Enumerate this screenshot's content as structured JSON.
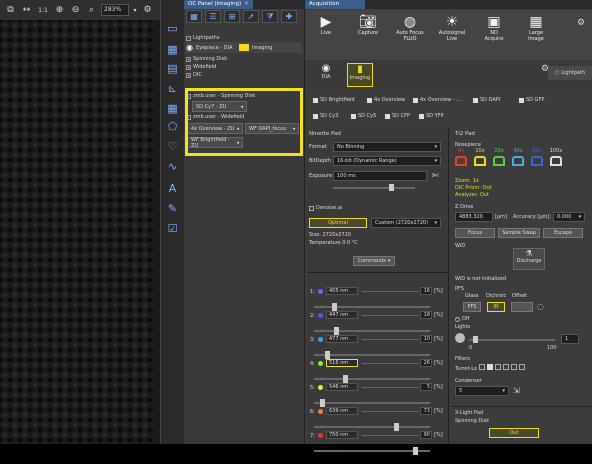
{
  "viewer": {
    "zoom": "283%",
    "scale_label": "1:1"
  },
  "oc_panel": {
    "tab": "OC Panel (Imaging)",
    "tree": [
      "Lightpaths",
      "Spinning Disk",
      "Widefield",
      "DIC"
    ],
    "eyepiece_label": "Eyepiece - DIA",
    "imaging_label": "Imaging",
    "groups": [
      {
        "header": "zmb.user - Spinning Disk",
        "items": [
          "SD Cy7 - ZU"
        ]
      },
      {
        "header": "zmb.user - Widefield",
        "items": [
          "4x Overview - ZU",
          "WF DAPI_focus",
          "WF Brightfield - ZU"
        ]
      }
    ]
  },
  "acq": {
    "tab": "Acquisition",
    "toolbar": [
      {
        "label": "Live",
        "sub": "",
        "icon": "play-icon"
      },
      {
        "label": "Capture",
        "sub": "",
        "icon": "camera-icon"
      },
      {
        "label": "Auto Focus",
        "sub": "FLUO",
        "icon": "autofocus-icon"
      },
      {
        "label": "Autosignal",
        "sub": "Live",
        "icon": "autosignal-icon"
      },
      {
        "label": "ND",
        "sub": "Acquire",
        "icon": "nd-icon"
      },
      {
        "label": "Large",
        "sub": "Image",
        "icon": "large-image-icon"
      }
    ],
    "modes": [
      {
        "label": "DIA"
      },
      {
        "label": "Imaging"
      }
    ],
    "lightpath_label": "Lightpath",
    "presets": [
      "SD Brightfield",
      "4x Overview",
      "4x Overview - ...",
      "SD DAPI",
      "SD GFP",
      "SD Cy3",
      "SD Cy5",
      "SD CFP",
      "SD YFP"
    ]
  },
  "camera": {
    "section": "Ninette Pad",
    "format_label": "Format",
    "format_value": "No Binning",
    "bitdepth_label": "BitDepth",
    "bitdepth_value": "16-bit (Dynamic Range)",
    "exposure_label": "Exposure",
    "exposure_value": "100 ms",
    "denoise_label": "Denoise.ai",
    "optimal_label": "Optimal",
    "custom_label": "Custom (2720x2720)",
    "size_label": "Size: 2720x2720",
    "temp_label": "Temperature 0.0 °C",
    "commands_label": "Commands"
  },
  "channels": [
    {
      "num": "1:",
      "name": "405 nm",
      "value": "16",
      "pct": "[%]",
      "color": "#7b5cff",
      "level": 16
    },
    {
      "num": "2:",
      "name": "447 nm",
      "value": "18",
      "pct": "[%]",
      "color": "#3f5bff",
      "level": 18
    },
    {
      "num": "3:",
      "name": "477 nm",
      "value": "10",
      "pct": "[%]",
      "color": "#2aa8ff",
      "level": 10
    },
    {
      "num": "4:",
      "name": "516 nm",
      "value": "26",
      "pct": "[%]",
      "color": "#6cff2a",
      "level": 26
    },
    {
      "num": "5:",
      "name": "546 nm",
      "value": "5",
      "pct": "[%]",
      "color": "#c8ff2a",
      "level": 5
    },
    {
      "num": "6:",
      "name": "639 nm",
      "value": "73",
      "pct": "[%]",
      "color": "#ff7a2a",
      "level": 73
    },
    {
      "num": "7:",
      "name": "750 nm",
      "value": "90",
      "pct": "[%]",
      "color": "#ff2a2a",
      "level": 90
    }
  ],
  "ti2": {
    "section": "Ti2 Pad",
    "nosepiece_label": "Nosepiece",
    "objectives": [
      {
        "mag": "4x",
        "color": "#e04040"
      },
      {
        "mag": "10x",
        "color": "#f0dc1a"
      },
      {
        "mag": "20x",
        "color": "#5ad040"
      },
      {
        "mag": "40x",
        "color": "#40b0e0"
      },
      {
        "mag": "60x",
        "color": "#4060e0"
      },
      {
        "mag": "100x",
        "color": "#dddddd"
      }
    ],
    "zoom_info": "Zoom: 1x",
    "dic_info": "DIC Prism: Out",
    "analyzer_info": "Analyzer: Out",
    "zdrive_label": "Z Drive",
    "z_value": "4883.320",
    "z_unit": "[µm]",
    "accuracy_label": "Accuracy [µm]:",
    "accuracy_value": "0.000",
    "focus_label": "Focus",
    "sample_swap_label": "Sample Swap",
    "escape_label": "Escape",
    "wid_label": "WiD",
    "discharge_label": "Discharge",
    "wid_status": "WiD is not initialized",
    "pfs_label": "PFS",
    "glass_label": "Glass",
    "dichroic_label": "Dichroic",
    "offset_label": "Offset",
    "pfs_btn": "PFS",
    "in_btn": "IN",
    "off_label": "Off",
    "lights_label": "Lights",
    "lights_zero": "0",
    "lights_hundred": "100",
    "lights_value": "1",
    "filters_label": "Filters",
    "turret_label": "Turret-Lo",
    "condenser_label": "Condenser",
    "condenser_value": "5",
    "xlight_label": "X-Light Pad",
    "spinning_label": "Spinning Disk",
    "out_label": "Out"
  }
}
